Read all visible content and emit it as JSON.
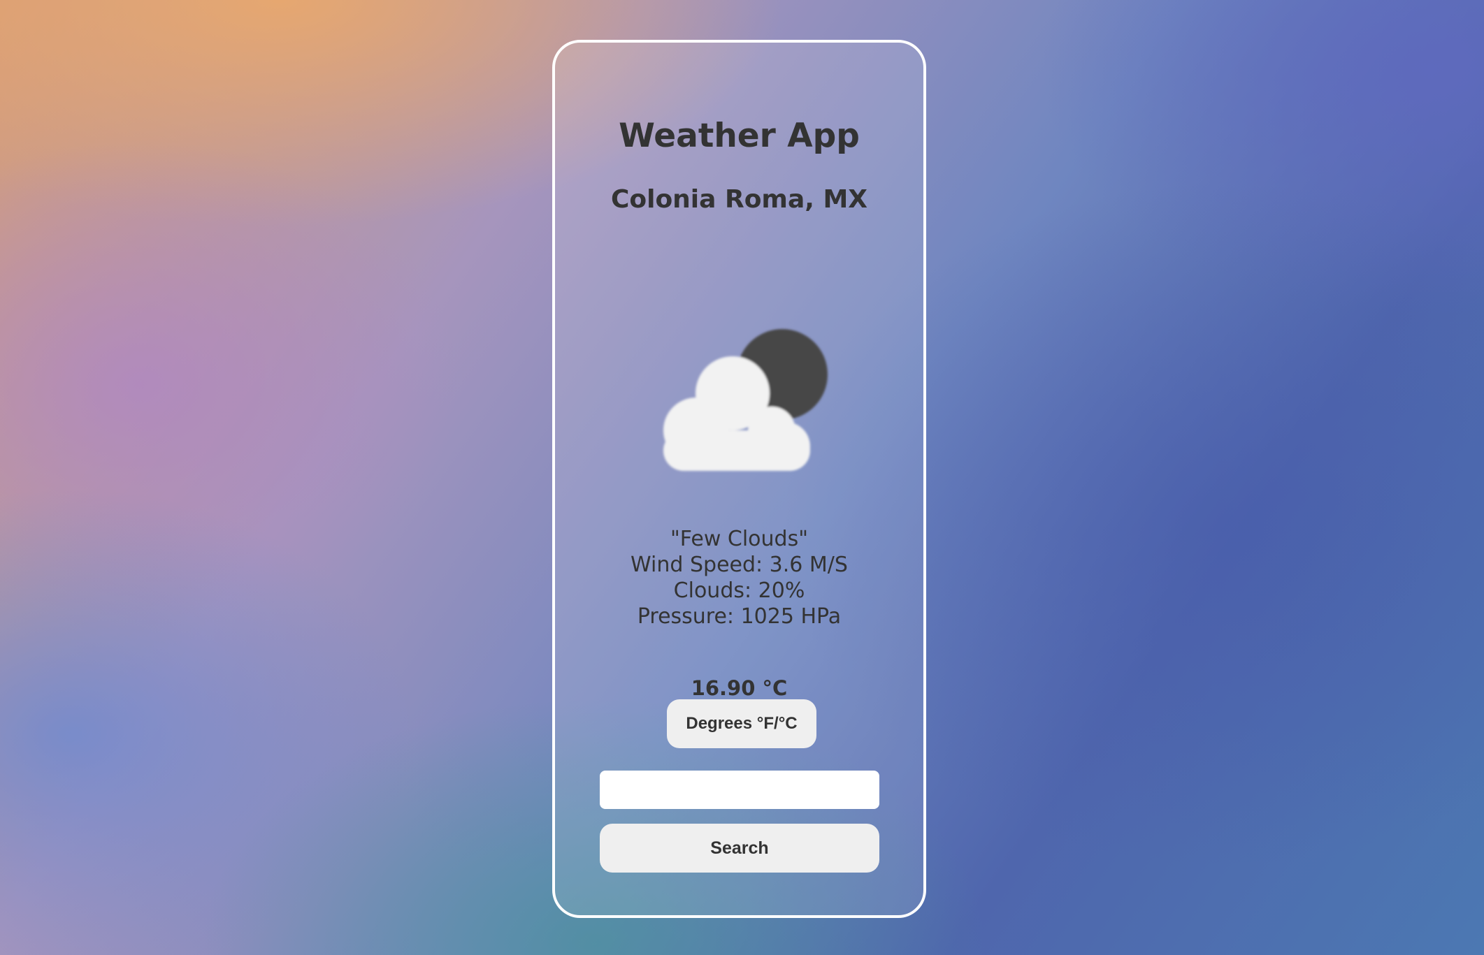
{
  "app": {
    "title": "Weather App",
    "location": "Colonia Roma, MX"
  },
  "weather": {
    "icon": "night-partly-cloudy-icon",
    "description": "\"Few Clouds\"",
    "wind_speed": "Wind Speed: 3.6 M/S",
    "clouds": "Clouds: 20%",
    "pressure": "Pressure: 1025 HPa",
    "temperature": "16.90 °C"
  },
  "controls": {
    "unit_toggle_label": "Degrees °F/°C",
    "search_value": "",
    "search_placeholder": "",
    "search_label": "Search"
  },
  "colors": {
    "text": "#333333",
    "card_border": "#ffffff",
    "button_bg": "#efefef",
    "moon": "#464646",
    "cloud": "#f2f2f2"
  }
}
